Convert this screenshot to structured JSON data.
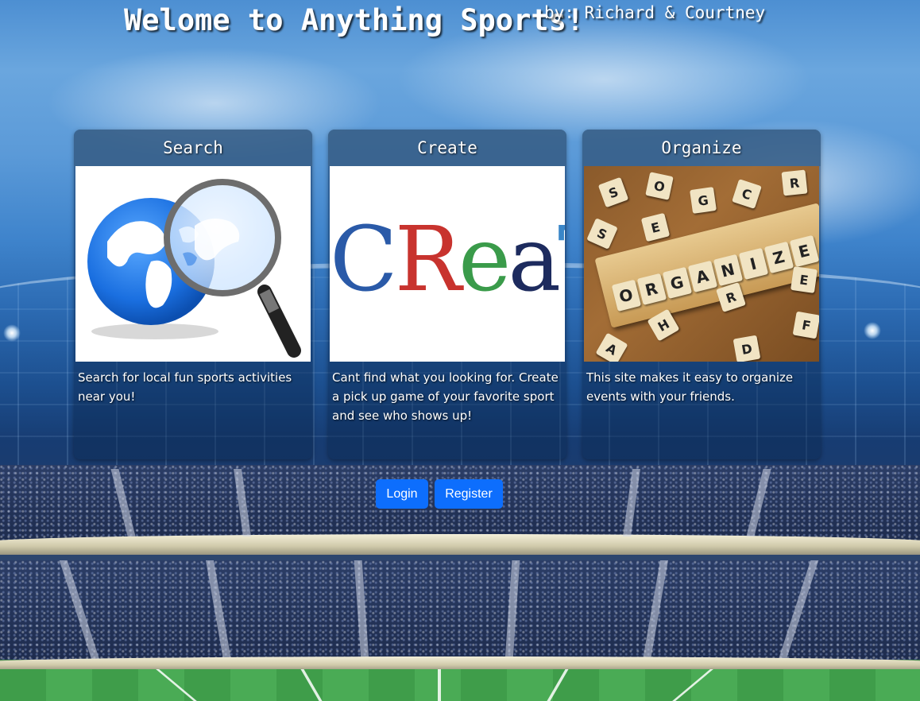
{
  "header": {
    "title": "Welome to Anything Sports!",
    "byline": "by: Richard & Courtney"
  },
  "cards": [
    {
      "heading": "Search",
      "image_icon": "globe-magnifying-glass-icon",
      "text": "Search for local fun sports activities near you!"
    },
    {
      "heading": "Create",
      "image_word": "CReaTe",
      "image_letter_colors": [
        "#2a5aa8",
        "#c8332e",
        "#3a9b4a",
        "#1d2b5e",
        "#3a86c8",
        "#b22236",
        "#e2772e"
      ],
      "text": "Cant find what you looking for. Create a pick up game of your favorite sport and see who shows up!"
    },
    {
      "heading": "Organize",
      "image_word": "ORGANIZE",
      "text": "This site makes it easy to organize events with your friends."
    }
  ],
  "buttons": {
    "login": "Login",
    "register": "Register"
  },
  "colors": {
    "button": "#0d6efd",
    "card_header": "#3c648c"
  }
}
